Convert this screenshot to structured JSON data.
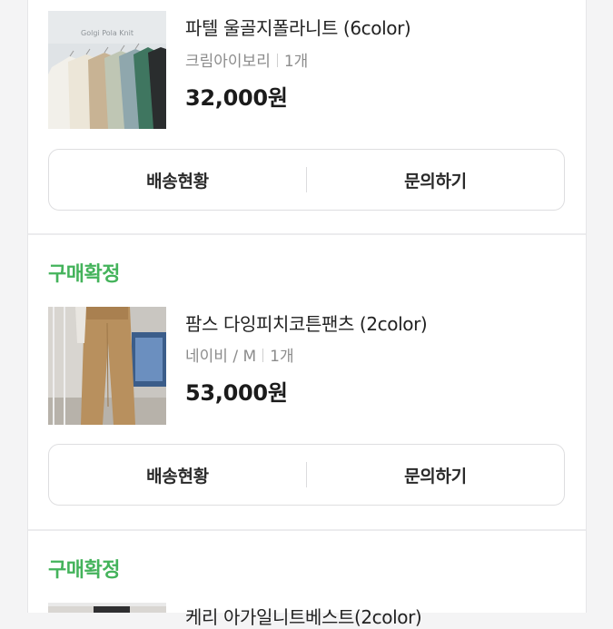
{
  "orders": [
    {
      "status": "",
      "product": {
        "name": "파텔 울골지폴라니트 (6color)",
        "option": "크림아이보리",
        "quantity": "1개",
        "price": "32,000원",
        "image_caption_1": "",
        "image_caption_2": "Golgi Pola Knit"
      },
      "actions": {
        "shipping_label": "배송현황",
        "inquiry_label": "문의하기"
      }
    },
    {
      "status": "구매확정",
      "product": {
        "name": "팜스 다잉피치코튼팬츠 (2color)",
        "option": "네이비 / M",
        "quantity": "1개",
        "price": "53,000원"
      },
      "actions": {
        "shipping_label": "배송현황",
        "inquiry_label": "문의하기"
      }
    },
    {
      "status": "구매확정",
      "product": {
        "name": "케리 아가일니트베스트(2color)"
      }
    }
  ],
  "colors": {
    "status_green": "#44b35b",
    "price": "#1b1b1b",
    "option_gray": "#8c8c8c"
  }
}
